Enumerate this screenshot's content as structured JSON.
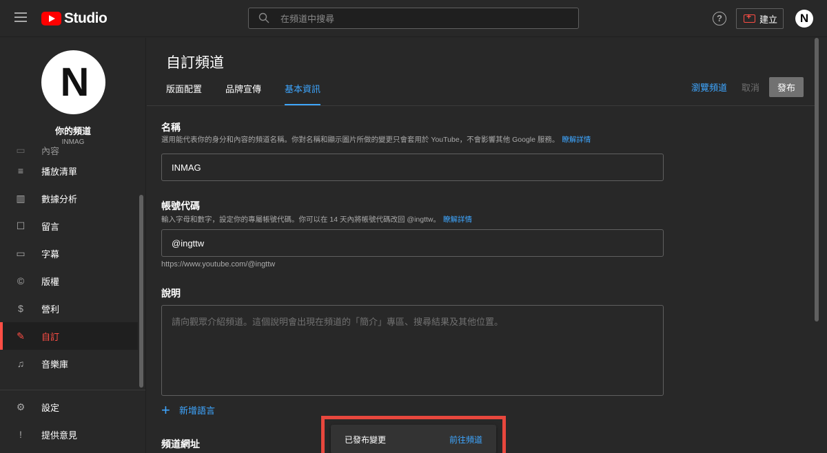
{
  "topbar": {
    "logo_text": "Studio",
    "search_placeholder": "在頻道中搜尋",
    "help_glyph": "?",
    "create_label": "建立",
    "avatar_letter": "N"
  },
  "sidebar": {
    "channel_title": "你的頻道",
    "channel_name": "INMAG",
    "avatar_letter": "N",
    "partial_item": "內容",
    "items": [
      {
        "label": "播放清單",
        "icon": "playlist-icon",
        "glyph": "≡"
      },
      {
        "label": "數據分析",
        "icon": "analytics-icon",
        "glyph": "▥"
      },
      {
        "label": "留言",
        "icon": "comments-icon",
        "glyph": "☐"
      },
      {
        "label": "字幕",
        "icon": "subtitles-icon",
        "glyph": "▭"
      },
      {
        "label": "版權",
        "icon": "copyright-icon",
        "glyph": "©"
      },
      {
        "label": "營利",
        "icon": "monetization-icon",
        "glyph": "$"
      },
      {
        "label": "自訂",
        "icon": "customization-icon",
        "glyph": "✎",
        "active": true
      },
      {
        "label": "音樂庫",
        "icon": "audio-library-icon",
        "glyph": "♫"
      }
    ],
    "bottom_items": [
      {
        "label": "設定",
        "icon": "settings-icon",
        "glyph": "⚙"
      },
      {
        "label": "提供意見",
        "icon": "feedback-icon",
        "glyph": "!"
      }
    ]
  },
  "main": {
    "title": "自訂頻道",
    "tabs": [
      {
        "label": "版面配置"
      },
      {
        "label": "品牌宣傳"
      },
      {
        "label": "基本資訊",
        "active": true
      }
    ],
    "actions": {
      "view_channel": "瀏覽頻道",
      "cancel": "取消",
      "publish": "發布"
    },
    "name_section": {
      "title": "名稱",
      "description": "選用能代表你的身分和內容的頻道名稱。你對名稱和顯示圖片所做的變更只會套用於 YouTube，不會影響其他 Google 服務。",
      "learn_more": "瞭解詳情",
      "value": "INMAG"
    },
    "handle_section": {
      "title": "帳號代碼",
      "description": "輸入字母和數字，設定你的專屬帳號代碼。你可以在 14 天內將帳號代碼改回 @ingttw。",
      "learn_more": "瞭解詳情",
      "value": "@ingttw",
      "url": "https://www.youtube.com/@ingttw"
    },
    "description_section": {
      "title": "說明",
      "placeholder": "請向觀眾介紹頻道。這個說明會出現在頻道的「簡介」專區、搜尋結果及其他位置。"
    },
    "add_language": "新增語言",
    "url_section_title": "頻道網址"
  },
  "snackbar": {
    "message": "已發布變更",
    "action": "前往頻道",
    "highlight_color": "#e8473d"
  },
  "colors": {
    "accent_blue": "#3ea6ff",
    "accent_red": "#ff4e45",
    "background": "#282828"
  }
}
